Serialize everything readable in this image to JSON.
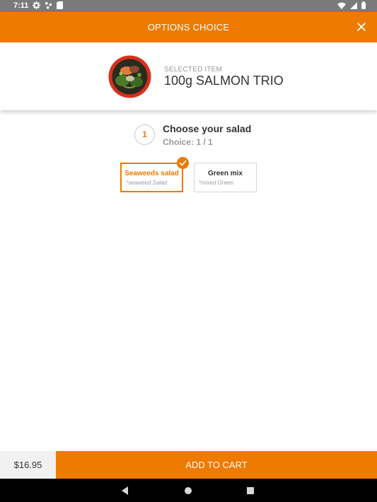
{
  "status_bar": {
    "time": "7:11",
    "icons": [
      "gear-icon",
      "network-icon",
      "sd-card-icon",
      "wifi-icon",
      "signal-icon",
      "battery-icon"
    ]
  },
  "header": {
    "title": "OPTIONS CHOICE",
    "close_icon": "close-icon"
  },
  "selected_item": {
    "label": "SELECTED ITEM",
    "name": "100g SALMON TRIO"
  },
  "step": {
    "number": "1",
    "title": "Choose your salad",
    "choice_text": "Choice: 1 / 1"
  },
  "options": [
    {
      "name": "Seaweeds salad",
      "description": "*seaweed Salad",
      "selected": true
    },
    {
      "name": "Green mix",
      "description": "*mixed Green",
      "selected": false
    }
  ],
  "footer": {
    "price": "$16.95",
    "add_to_cart": "ADD TO CART"
  },
  "nav_bar": {
    "icons": [
      "back-icon",
      "home-icon",
      "recents-icon"
    ]
  },
  "colors": {
    "accent": "#ee7a00",
    "status_bar": "#7a7a7a",
    "price_bg": "#f1f1f1",
    "text_dark": "#333333",
    "text_muted": "#9a9a9a"
  }
}
